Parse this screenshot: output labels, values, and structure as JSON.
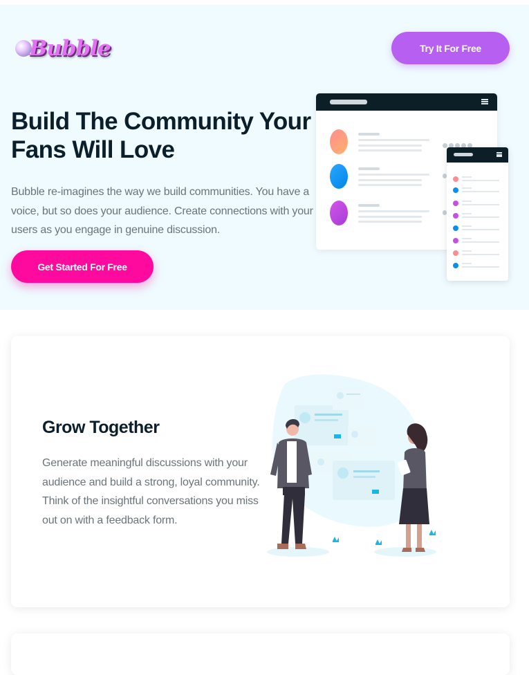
{
  "header": {
    "logo_text": "Bubble",
    "try_button": "Try It For Free"
  },
  "hero": {
    "title": "Build The Community Your Fans Will Love",
    "description": "Bubble re-imagines the way we build communities. You have a voice, but so does your audience. Create connections with your users as you engage in genuine discussion.",
    "cta_button": "Get Started For Free"
  },
  "feature": {
    "title": "Grow Together",
    "description": "Generate meaningful discussions with your audience and build a strong, loyal community. Think of the insightful conversations you miss out on with a feedback form."
  },
  "colors": {
    "hero_background": "#effbff",
    "try_button": "#b65ff0",
    "cta_button": "#ff0a9f",
    "heading": "#0a1e2b",
    "body_text": "#6a7479"
  },
  "icons": [
    "bubble-logo-icon",
    "menu-icon",
    "user-avatar-icon"
  ]
}
